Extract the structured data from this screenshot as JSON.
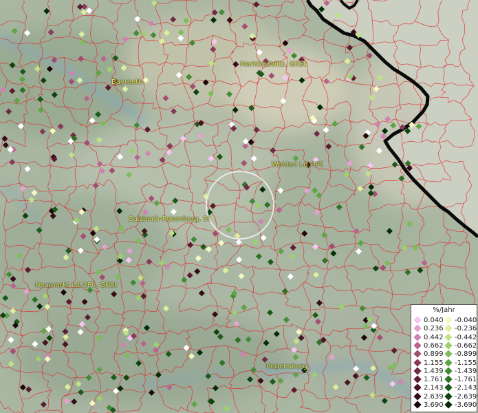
{
  "legend": {
    "title": "%/Jahr",
    "positive": [
      {
        "label": "0.040",
        "color": "#f6c6f2"
      },
      {
        "label": "0.236",
        "color": "#e4a2cf"
      },
      {
        "label": "0.442",
        "color": "#cf84b3"
      },
      {
        "label": "0.662",
        "color": "#b9668f"
      },
      {
        "label": "0.899",
        "color": "#a24e72"
      },
      {
        "label": "1.155",
        "color": "#893a58"
      },
      {
        "label": "1.439",
        "color": "#702b44"
      },
      {
        "label": "1.761",
        "color": "#5a1d30"
      },
      {
        "label": "2.143",
        "color": "#461422"
      },
      {
        "label": "2.639",
        "color": "#330c17"
      },
      {
        "label": "3.690",
        "color": "#1e050b"
      }
    ],
    "negative": [
      {
        "label": "-0.040",
        "color": "#f4f8c2"
      },
      {
        "label": "-0.236",
        "color": "#dcef9f"
      },
      {
        "label": "-0.442",
        "color": "#c0e287"
      },
      {
        "label": "-0.662",
        "color": "#9fd070"
      },
      {
        "label": "-0.899",
        "color": "#7fbc5c"
      },
      {
        "label": "-1.155",
        "color": "#5fa447"
      },
      {
        "label": "-1.439",
        "color": "#438b36"
      },
      {
        "label": "-1.761",
        "color": "#2d7227"
      },
      {
        "label": "-2.143",
        "color": "#1b5a1b"
      },
      {
        "label": "-2.639",
        "color": "#0e4310"
      },
      {
        "label": "-3.690",
        "color": "#052c06"
      }
    ]
  },
  "places": [
    {
      "id": "marktredwitz",
      "label": "Marktredwitz, GKSt"
    },
    {
      "id": "bayreuth",
      "label": "Bayreuth"
    },
    {
      "id": "weiden",
      "label": "Weiden i.d.OPf."
    },
    {
      "id": "sulzbach",
      "label": "Sulzbach-Rosenberg, St"
    },
    {
      "id": "neumarkt",
      "label": "Neumarkt i.d.OPf., GKSt"
    },
    {
      "id": "regensburg",
      "label": "Regensburg"
    }
  ],
  "colors": {
    "white_station": "#ffffff",
    "boundary_line": "#e0242a",
    "country_border": "#0a0a0a",
    "selection_ring": "#f2f2f2"
  }
}
